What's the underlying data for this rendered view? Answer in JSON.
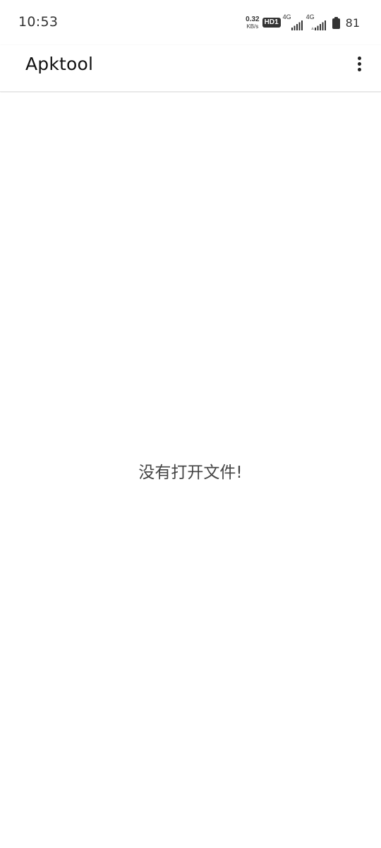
{
  "status_bar": {
    "time": "10:53",
    "net_speed_value": "0.32",
    "net_speed_unit": "KB/s",
    "hd_badge": "HD1",
    "sim1_type": "4G",
    "sim2_type": "4G",
    "battery_level": "81"
  },
  "app_bar": {
    "title": "Apktool",
    "menu_icon": "more-vert-icon"
  },
  "content": {
    "empty_message": "没有打开文件!"
  },
  "colors": {
    "background": "#ffffff",
    "text_primary": "#111111",
    "text_secondary": "#444444",
    "status_icons": "#333333"
  }
}
